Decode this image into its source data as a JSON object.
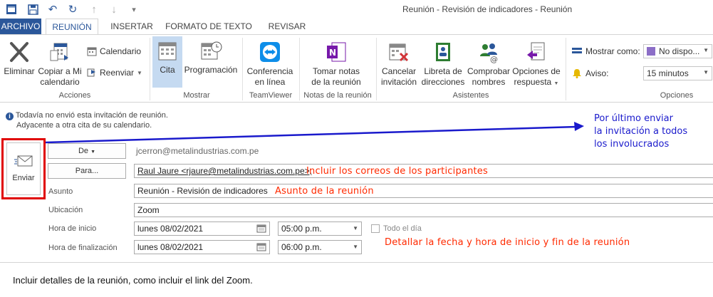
{
  "window": {
    "title": "Reunión - Revisión de indicadores - Reunión"
  },
  "tabs": [
    {
      "label": "ARCHIVO"
    },
    {
      "label": "REUNIÓN"
    },
    {
      "label": "INSERTAR"
    },
    {
      "label": "FORMATO DE TEXTO"
    },
    {
      "label": "REVISAR"
    }
  ],
  "ribbon": {
    "acciones": {
      "group": "Acciones",
      "delete": "Eliminar",
      "copy_l1": "Copiar a Mi",
      "copy_l2": "calendario",
      "calendar": "Calendario",
      "forward": "Reenviar"
    },
    "mostrar": {
      "group": "Mostrar",
      "appointment": "Cita",
      "scheduling": "Programación"
    },
    "teamviewer": {
      "group": "TeamViewer",
      "l1": "Conferencia",
      "l2": "en línea"
    },
    "notas": {
      "group": "Notas de la reunión",
      "l1": "Tomar notas",
      "l2": "de la reunión"
    },
    "asistentes": {
      "group": "Asistentes",
      "cancel_l1": "Cancelar",
      "cancel_l2": "invitación",
      "book_l1": "Libreta de",
      "book_l2": "direcciones",
      "check_l1": "Comprobar",
      "check_l2": "nombres",
      "resp_l1": "Opciones de",
      "resp_l2": "respuesta"
    },
    "opciones": {
      "group": "Opciones",
      "show_as_label": "Mostrar como:",
      "show_as_value": "No dispo...",
      "reminder_label": "Aviso:",
      "reminder_value": "15 minutos"
    }
  },
  "info": {
    "line1": "Todavía no envió esta invitación de reunión.",
    "line2": "Adyacente a otra cita de su calendario."
  },
  "form": {
    "send": "Enviar",
    "from_btn": "De",
    "from_value": "jcerron@metalindustrias.com.pe",
    "to_btn": "Para...",
    "to_value": "Raul Jaure <rjaure@metalindustrias.com.pe>;",
    "subject_label": "Asunto",
    "subject_value": "Reunión - Revisión de indicadores",
    "location_label": "Ubicación",
    "location_value": "Zoom",
    "start_label": "Hora de inicio",
    "start_date": "lunes 08/02/2021",
    "start_time": "05:00 p.m.",
    "allday_label": "Todo el día",
    "end_label": "Hora de finalización",
    "end_date": "lunes 08/02/2021",
    "end_time": "06:00 p.m."
  },
  "body_text": "Incluir detalles de la reunión, como incluir el link del Zoom.",
  "annotations": {
    "send_note_l1": "Por último enviar",
    "send_note_l2": "la invitación a todos",
    "send_note_l3": "los involucrados",
    "participants": "Incluir los correos de los participantes",
    "subject": "Asunto de la reunión",
    "datetime": "Detallar la fecha y hora de inicio y fin de la reunión"
  },
  "colors": {
    "accent": "#2b579a",
    "annotation_red": "#ff2a00",
    "annotation_blue": "#1a1acc",
    "highlight_box": "#e00000"
  }
}
